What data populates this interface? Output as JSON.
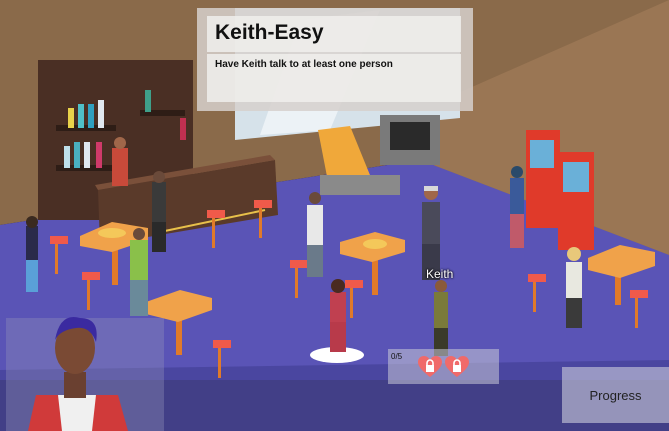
{
  "quest": {
    "title": "Keith-Easy",
    "description": "Have Keith talk to at least one person"
  },
  "npc_label": "Keith",
  "hearts": {
    "count_text": "0/5",
    "icons": [
      "locked-heart-icon",
      "locked-heart-icon"
    ]
  },
  "progress_button": "Progress",
  "colors": {
    "floor": "#5a55b8",
    "wall": "#8c6a4a",
    "heart": "#f06a6a",
    "table_top": "#f0a24a",
    "arcade": "#e33a2a"
  }
}
